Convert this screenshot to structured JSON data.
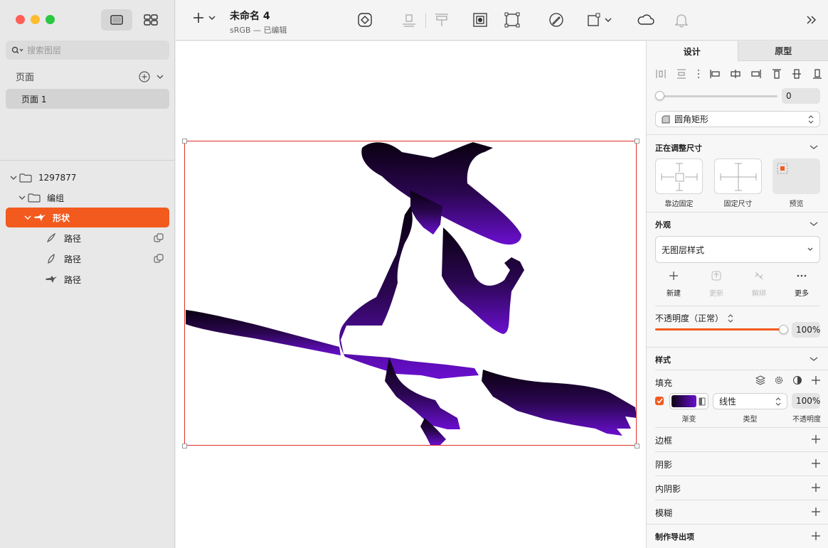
{
  "sidebar": {
    "search_placeholder": "搜索图层",
    "pages_label": "页面",
    "page_items": [
      "页面 1"
    ],
    "layers": [
      {
        "name": "1297877"
      },
      {
        "name": "编组"
      },
      {
        "name": "形状"
      },
      {
        "name": "路径"
      },
      {
        "name": "路径"
      },
      {
        "name": "路径"
      }
    ]
  },
  "toolbar": {
    "doc_title": "未命名 4",
    "doc_subtitle": "sRGB — 已编辑"
  },
  "inspector": {
    "tabs": [
      "设计",
      "原型"
    ],
    "corner_value": "0",
    "shape_type": "圆角矩形",
    "resizing": {
      "title": "正在调整尺寸",
      "options": [
        "靠边固定",
        "固定尺寸",
        "预览"
      ]
    },
    "appearance": {
      "title": "外观",
      "layer_style": "无图层样式",
      "actions": [
        "新建",
        "更新",
        "解绑",
        "更多"
      ],
      "opacity_label": "不透明度（正常）",
      "opacity_value": "100%"
    },
    "style": {
      "title": "样式",
      "fill_label": "填充",
      "fill_type": "线性",
      "fill_opacity": "100%",
      "fill_sub_labels": [
        "渐变",
        "类型",
        "不透明度"
      ],
      "gradient_colors": [
        "#0a0010",
        "#6a0fd0"
      ]
    },
    "sections": [
      "边框",
      "阴影",
      "内阴影",
      "模糊",
      "制作导出项"
    ]
  },
  "colors": {
    "selection": "#f25a1e",
    "accent": "#f25a1e"
  }
}
